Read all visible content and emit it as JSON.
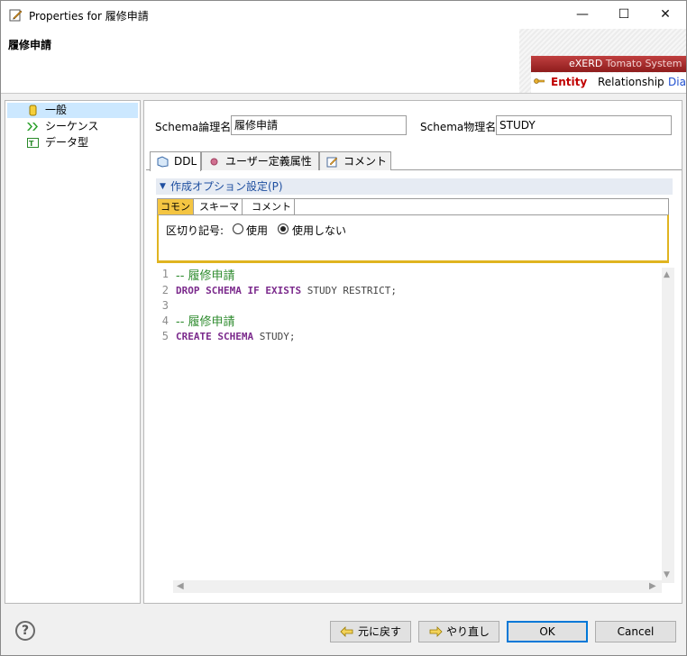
{
  "window": {
    "title": "Properties for 履修申請",
    "minimize": "—",
    "maximize": "☐",
    "close": "✕"
  },
  "header": {
    "entity_title": "履修申請",
    "brand_name": "eXERD",
    "brand_tagline": "Tomato System",
    "nav": {
      "entity": "Entity",
      "relationship": "Relationship",
      "diagram": "Diag"
    }
  },
  "tree": {
    "items": [
      {
        "label": "一般",
        "icon": "database-icon",
        "selected": true
      },
      {
        "label": "シーケンス",
        "icon": "sequence-icon",
        "selected": false
      },
      {
        "label": "データ型",
        "icon": "datatype-icon",
        "selected": false
      }
    ]
  },
  "schema": {
    "logical_label": "Schema論理名",
    "logical_value": "履修申請",
    "physical_label": "Schema物理名",
    "physical_value": "STUDY"
  },
  "tabs": [
    {
      "label": "DDL",
      "icon": "ddl-icon",
      "active": true
    },
    {
      "label": "ユーザー定義属性",
      "icon": "dot-icon",
      "active": false
    },
    {
      "label": "コメント",
      "icon": "comment-icon",
      "active": false
    }
  ],
  "options": {
    "header": "作成オプション設定(P)",
    "subtabs": [
      "コモン",
      "スキーマ",
      "コメント"
    ],
    "delimiter_label": "区切り記号:",
    "radio_use": "使用",
    "radio_nouse": "使用しない",
    "selected": "使用しない"
  },
  "ddl": {
    "lines": [
      {
        "num": "1",
        "comment": "-- 履修申請"
      },
      {
        "num": "2",
        "kw": "DROP SCHEMA IF EXISTS",
        "rest": " STUDY RESTRICT;"
      },
      {
        "num": "3"
      },
      {
        "num": "4",
        "comment": "-- 履修申請"
      },
      {
        "num": "5",
        "kw": "CREATE SCHEMA",
        "rest": " STUDY;"
      }
    ]
  },
  "buttons": {
    "help": "?",
    "undo": "元に戻す",
    "redo": "やり直し",
    "ok": "OK",
    "cancel": "Cancel"
  },
  "colors": {
    "accent": "#0078d7",
    "brand": "#a02828",
    "keyword": "#7b2a8c",
    "comment": "#2e8b2e",
    "subtab_active": "#f4c542"
  }
}
